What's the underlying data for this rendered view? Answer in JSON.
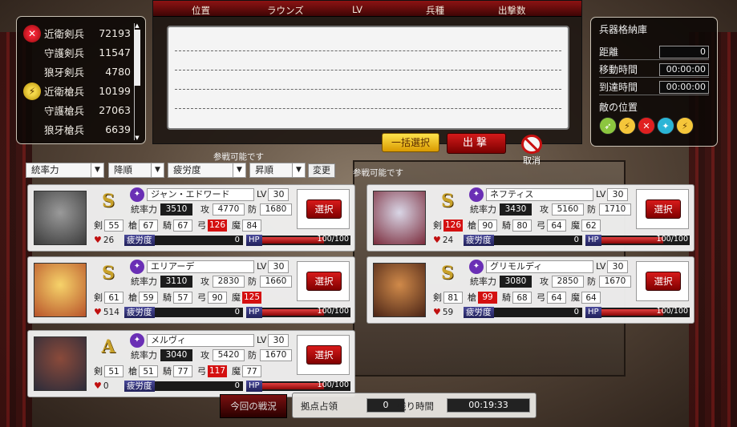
{
  "troops": [
    {
      "name": "近衛剣兵",
      "count": "72193",
      "icon": "sword-icon"
    },
    {
      "name": "守護剣兵",
      "count": "11547",
      "icon": ""
    },
    {
      "name": "狼牙剣兵",
      "count": "4780",
      "icon": ""
    },
    {
      "name": "近衛槍兵",
      "count": "10199",
      "icon": "spear-icon"
    },
    {
      "name": "守護槍兵",
      "count": "27063",
      "icon": ""
    },
    {
      "name": "狼牙槍兵",
      "count": "6639",
      "icon": ""
    }
  ],
  "formation": {
    "headers": [
      "位置",
      "ラウンズ",
      "LV",
      "兵種",
      "出撃数"
    ]
  },
  "buttons": {
    "bulk_select": "一括選択",
    "sortie": "出撃",
    "cancel": "取消",
    "change": "変更"
  },
  "storage": {
    "title": "兵器格納庫",
    "distance_label": "距離",
    "distance": "0",
    "move_time_label": "移動時間",
    "move_time": "00:00:00",
    "arrival_label": "到達時間",
    "arrival": "00:00:00",
    "enemy_label": "敵の位置"
  },
  "sort": {
    "key1": "統率力",
    "order1": "降順",
    "key2": "疲労度",
    "order2": "昇順"
  },
  "hints": {
    "can_battle": "参戦可能です"
  },
  "cards": [
    {
      "rank": "S",
      "name": "ジャン・エドワード",
      "lv": "30",
      "command": "3510",
      "atk": "4770",
      "def": "1680",
      "sword": "55",
      "spear": "67",
      "cav": "67",
      "bow": "126",
      "magic": "84",
      "bow_red": true,
      "magic_red": false,
      "heart": "26",
      "fatigue": "0",
      "hp": "100/100",
      "hp_frac": 1.0,
      "select": "選択"
    },
    {
      "rank": "S",
      "name": "ネフティス",
      "lv": "30",
      "command": "3430",
      "atk": "5160",
      "def": "1710",
      "sword": "126",
      "spear": "90",
      "cav": "80",
      "bow": "64",
      "magic": "62",
      "sword_red": true,
      "heart": "24",
      "fatigue": "0",
      "hp": "100/100",
      "hp_frac": 1.0,
      "select": "選択"
    },
    {
      "rank": "S",
      "name": "エリアーデ",
      "lv": "30",
      "command": "3110",
      "atk": "2830",
      "def": "1660",
      "sword": "61",
      "spear": "59",
      "cav": "57",
      "bow": "90",
      "magic": "125",
      "magic_red": true,
      "heart": "514",
      "fatigue": "0",
      "hp": "100/100",
      "hp_frac": 1.0,
      "select": "選択"
    },
    {
      "rank": "S",
      "name": "グリモルディ",
      "lv": "30",
      "command": "3080",
      "atk": "2850",
      "def": "1670",
      "sword": "81",
      "spear": "99",
      "cav": "68",
      "bow": "64",
      "magic": "64",
      "spear_red": true,
      "heart": "59",
      "fatigue": "0",
      "hp": "100/100",
      "hp_frac": 1.0,
      "select": "選択"
    },
    {
      "rank": "A",
      "name": "メルヴィ",
      "lv": "30",
      "command": "3040",
      "atk": "5420",
      "def": "1670",
      "sword": "51",
      "spear": "51",
      "cav": "77",
      "bow": "117",
      "magic": "77",
      "bow_red": true,
      "heart": "0",
      "fatigue": "0",
      "hp": "100/100",
      "hp_frac": 1.0,
      "select": "選択"
    }
  ],
  "card_labels": {
    "lv": "LV",
    "command": "統率力",
    "atk": "攻",
    "def": "防",
    "sword": "剣",
    "spear": "槍",
    "cav": "騎",
    "bow": "弓",
    "magic": "魔",
    "fatigue": "疲労度",
    "hp": "HP"
  },
  "bottom": {
    "battle_status": "今回の戦況",
    "occupation_label": "拠点占領",
    "occupation": "0",
    "remaining_label": "残り時間",
    "remaining": "00:19:33"
  }
}
